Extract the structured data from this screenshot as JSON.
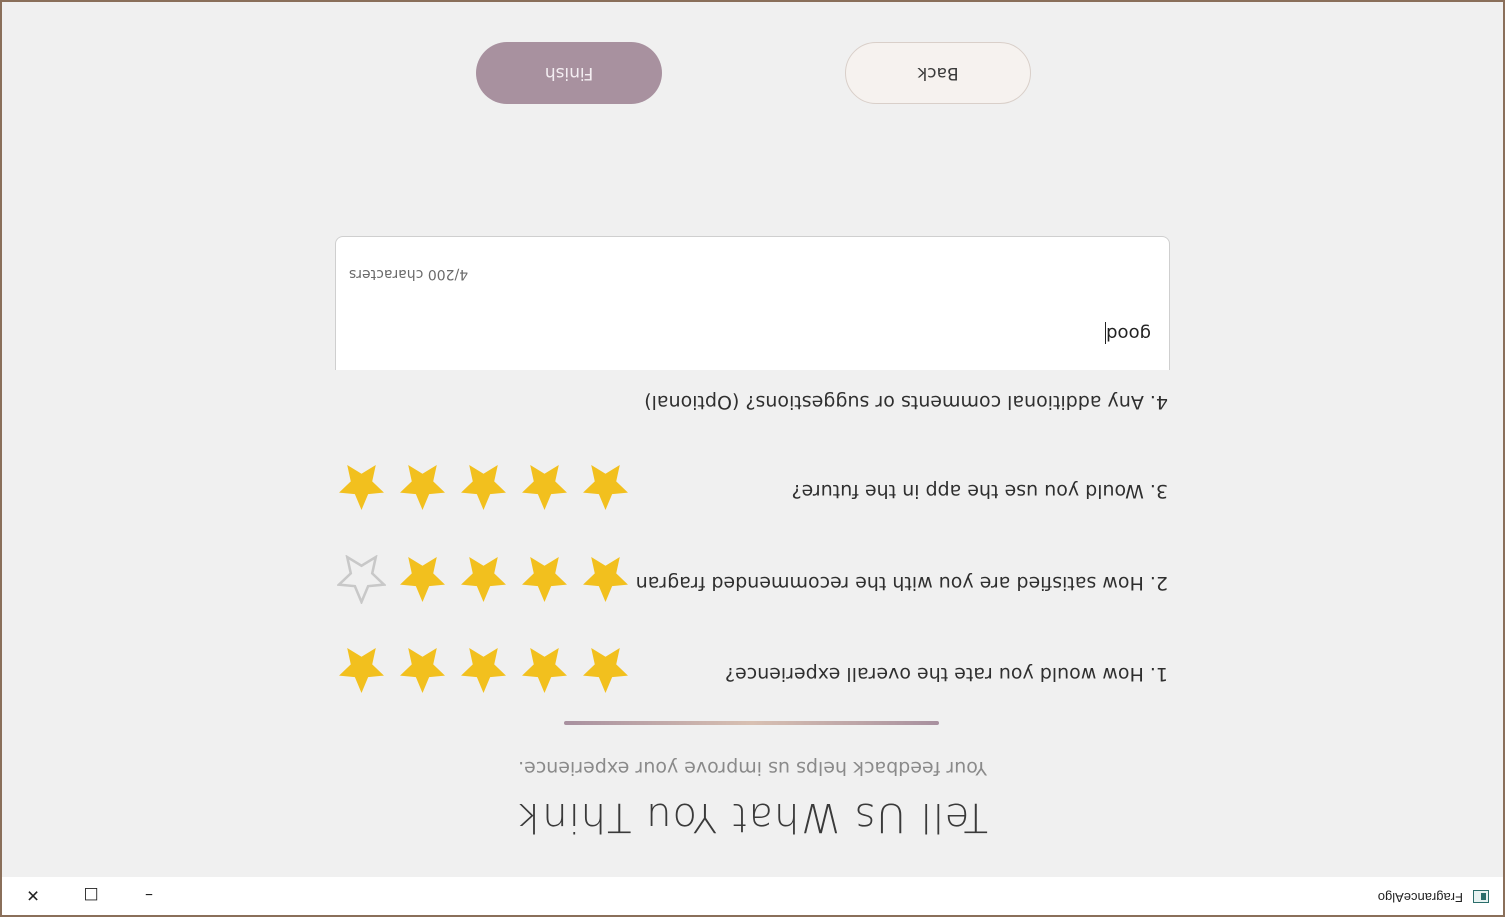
{
  "window": {
    "app_title": "FragranceAlgo",
    "controls": {
      "minimize": "–",
      "maximize": "□",
      "close": "✕"
    }
  },
  "header": {
    "title": "Tell Us What You Think",
    "subtitle": "Your feedback helps us improve your experience."
  },
  "questions": [
    {
      "label": "1. How would you rate the overall experience?",
      "rating": 5,
      "max": 5
    },
    {
      "label": "2. How satisfied are you with the recommended fragran",
      "rating": 4,
      "max": 5
    },
    {
      "label": "3. Would you use the app in the future?",
      "rating": 5,
      "max": 5
    },
    {
      "label": "4. Any additional comments or suggestions? (Optional)"
    }
  ],
  "comment": {
    "value": "good",
    "char_count": "4/200 characters"
  },
  "buttons": {
    "back": "Back",
    "finish": "Finish"
  },
  "colors": {
    "star_filled": "#f2c01e",
    "star_empty": "#c8c8c8",
    "finish_bg": "#a8919f"
  }
}
